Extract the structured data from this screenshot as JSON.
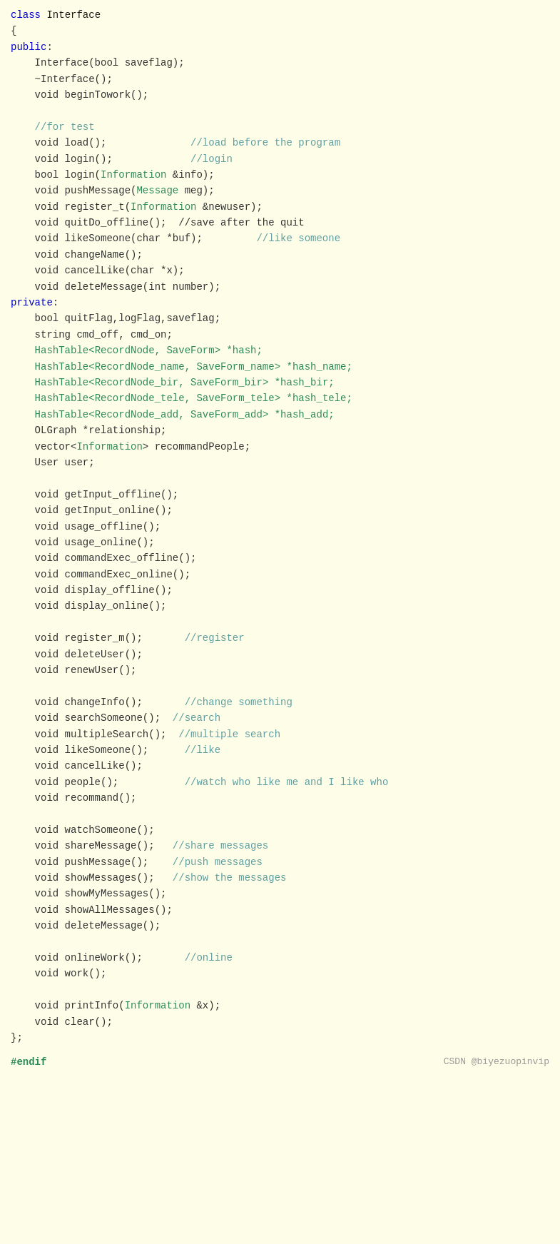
{
  "title": "Interface",
  "footer": {
    "left": "#endif",
    "right": "CSDN @biyezuopinvip"
  },
  "code": {
    "lines": [
      {
        "id": 1,
        "parts": [
          {
            "text": "class ",
            "style": "kw"
          },
          {
            "text": "Interface",
            "style": "class-name"
          }
        ]
      },
      {
        "id": 2,
        "parts": [
          {
            "text": "{",
            "style": "punct"
          }
        ]
      },
      {
        "id": 3,
        "parts": [
          {
            "text": "public",
            "style": "kw"
          },
          {
            "text": ":",
            "style": "punct"
          }
        ]
      },
      {
        "id": 4,
        "parts": [
          {
            "text": "    Interface(bool saveflag);",
            "style": "method"
          }
        ]
      },
      {
        "id": 5,
        "parts": [
          {
            "text": "    ~Interface();",
            "style": "method"
          }
        ]
      },
      {
        "id": 6,
        "parts": [
          {
            "text": "    void beginTowork();",
            "style": "method"
          }
        ]
      },
      {
        "id": 7,
        "parts": [
          {
            "text": "",
            "style": ""
          }
        ]
      },
      {
        "id": 8,
        "parts": [
          {
            "text": "    //for test",
            "style": "comment"
          }
        ]
      },
      {
        "id": 9,
        "parts": [
          {
            "text": "    void load();",
            "style": "method"
          },
          {
            "text": "              //load before the program",
            "style": "comment"
          }
        ]
      },
      {
        "id": 10,
        "parts": [
          {
            "text": "    void login();",
            "style": "method"
          },
          {
            "text": "             //login",
            "style": "comment"
          }
        ]
      },
      {
        "id": 11,
        "parts": [
          {
            "text": "    bool login(",
            "style": "method"
          },
          {
            "text": "Information",
            "style": "type-name"
          },
          {
            "text": " &info);",
            "style": "method"
          }
        ]
      },
      {
        "id": 12,
        "parts": [
          {
            "text": "    void pushMessage(",
            "style": "method"
          },
          {
            "text": "Message",
            "style": "type-name"
          },
          {
            "text": " meg);",
            "style": "method"
          }
        ]
      },
      {
        "id": 13,
        "parts": [
          {
            "text": "    void register_t(",
            "style": "method"
          },
          {
            "text": "Information",
            "style": "type-name"
          },
          {
            "text": " &newuser);",
            "style": "method"
          }
        ]
      },
      {
        "id": 14,
        "parts": [
          {
            "text": "    void quitDo_offline();  //save after the quit",
            "style": "method"
          },
          {
            "text": "",
            "style": "comment"
          }
        ]
      },
      {
        "id": 15,
        "parts": [
          {
            "text": "    void likeSomeone(char *buf);",
            "style": "method"
          },
          {
            "text": "         //like someone",
            "style": "comment"
          }
        ]
      },
      {
        "id": 16,
        "parts": [
          {
            "text": "    void changeName();",
            "style": "method"
          }
        ]
      },
      {
        "id": 17,
        "parts": [
          {
            "text": "    void cancelLike(char *x);",
            "style": "method"
          }
        ]
      },
      {
        "id": 18,
        "parts": [
          {
            "text": "    void deleteMessage(int number);",
            "style": "method"
          }
        ]
      },
      {
        "id": 19,
        "parts": [
          {
            "text": "private",
            "style": "kw"
          },
          {
            "text": ":",
            "style": "punct"
          }
        ]
      },
      {
        "id": 20,
        "parts": [
          {
            "text": "    bool quitFlag,logFlag,saveflag;",
            "style": "method"
          }
        ]
      },
      {
        "id": 21,
        "parts": [
          {
            "text": "    string cmd_off, cmd_on;",
            "style": "method"
          }
        ]
      },
      {
        "id": 22,
        "parts": [
          {
            "text": "    HashTable<",
            "style": "type-name"
          },
          {
            "text": "RecordNode, SaveForm",
            "style": "type-name"
          },
          {
            "text": "> *hash;",
            "style": "type-name"
          }
        ]
      },
      {
        "id": 23,
        "parts": [
          {
            "text": "    HashTable<",
            "style": "type-name"
          },
          {
            "text": "RecordNode_name, SaveForm_name",
            "style": "type-name"
          },
          {
            "text": "> *hash_name;",
            "style": "type-name"
          }
        ]
      },
      {
        "id": 24,
        "parts": [
          {
            "text": "    HashTable<",
            "style": "type-name"
          },
          {
            "text": "RecordNode_bir, SaveForm_bir",
            "style": "type-name"
          },
          {
            "text": "> *hash_bir;",
            "style": "type-name"
          }
        ]
      },
      {
        "id": 25,
        "parts": [
          {
            "text": "    HashTable<",
            "style": "type-name"
          },
          {
            "text": "RecordNode_tele, SaveForm_tele",
            "style": "type-name"
          },
          {
            "text": "> *hash_tele;",
            "style": "type-name"
          }
        ]
      },
      {
        "id": 26,
        "parts": [
          {
            "text": "    HashTable<",
            "style": "type-name"
          },
          {
            "text": "RecordNode_add, SaveForm_add",
            "style": "type-name"
          },
          {
            "text": "> *hash_add;",
            "style": "type-name"
          }
        ]
      },
      {
        "id": 27,
        "parts": [
          {
            "text": "    OLGraph *relationship;",
            "style": "method"
          }
        ]
      },
      {
        "id": 28,
        "parts": [
          {
            "text": "    vector<",
            "style": "method"
          },
          {
            "text": "Information",
            "style": "type-name"
          },
          {
            "text": "> recommandPeople;",
            "style": "method"
          }
        ]
      },
      {
        "id": 29,
        "parts": [
          {
            "text": "    User user;",
            "style": "method"
          }
        ]
      },
      {
        "id": 30,
        "parts": [
          {
            "text": "",
            "style": ""
          }
        ]
      },
      {
        "id": 31,
        "parts": [
          {
            "text": "    void getInput_offline();",
            "style": "method"
          }
        ]
      },
      {
        "id": 32,
        "parts": [
          {
            "text": "    void getInput_online();",
            "style": "method"
          }
        ]
      },
      {
        "id": 33,
        "parts": [
          {
            "text": "    void usage_offline();",
            "style": "method"
          }
        ]
      },
      {
        "id": 34,
        "parts": [
          {
            "text": "    void usage_online();",
            "style": "method"
          }
        ]
      },
      {
        "id": 35,
        "parts": [
          {
            "text": "    void commandExec_offline();",
            "style": "method"
          }
        ]
      },
      {
        "id": 36,
        "parts": [
          {
            "text": "    void commandExec_online();",
            "style": "method"
          }
        ]
      },
      {
        "id": 37,
        "parts": [
          {
            "text": "    void display_offline();",
            "style": "method"
          }
        ]
      },
      {
        "id": 38,
        "parts": [
          {
            "text": "    void display_online();",
            "style": "method"
          }
        ]
      },
      {
        "id": 39,
        "parts": [
          {
            "text": "",
            "style": ""
          }
        ]
      },
      {
        "id": 40,
        "parts": [
          {
            "text": "    void register_m();",
            "style": "method"
          },
          {
            "text": "       //register",
            "style": "comment"
          }
        ]
      },
      {
        "id": 41,
        "parts": [
          {
            "text": "    void deleteUser();",
            "style": "method"
          }
        ]
      },
      {
        "id": 42,
        "parts": [
          {
            "text": "    void renewUser();",
            "style": "method"
          }
        ]
      },
      {
        "id": 43,
        "parts": [
          {
            "text": "",
            "style": ""
          }
        ]
      },
      {
        "id": 44,
        "parts": [
          {
            "text": "    void changeInfo();",
            "style": "method"
          },
          {
            "text": "       //change something",
            "style": "comment"
          }
        ]
      },
      {
        "id": 45,
        "parts": [
          {
            "text": "    void searchSomeone();",
            "style": "method"
          },
          {
            "text": "  //search",
            "style": "comment"
          }
        ]
      },
      {
        "id": 46,
        "parts": [
          {
            "text": "    void multipleSearch();",
            "style": "method"
          },
          {
            "text": "  //multiple search",
            "style": "comment"
          }
        ]
      },
      {
        "id": 47,
        "parts": [
          {
            "text": "    void likeSomeone();",
            "style": "method"
          },
          {
            "text": "      //like",
            "style": "comment"
          }
        ]
      },
      {
        "id": 48,
        "parts": [
          {
            "text": "    void cancelLike();",
            "style": "method"
          }
        ]
      },
      {
        "id": 49,
        "parts": [
          {
            "text": "    void people();",
            "style": "method"
          },
          {
            "text": "           //watch who like me and I like who",
            "style": "comment"
          }
        ]
      },
      {
        "id": 50,
        "parts": [
          {
            "text": "    void recommand();",
            "style": "method"
          }
        ]
      },
      {
        "id": 51,
        "parts": [
          {
            "text": "",
            "style": ""
          }
        ]
      },
      {
        "id": 52,
        "parts": [
          {
            "text": "    void watchSomeone();",
            "style": "method"
          }
        ]
      },
      {
        "id": 53,
        "parts": [
          {
            "text": "    void shareMessage();",
            "style": "method"
          },
          {
            "text": "   //share messages",
            "style": "comment"
          }
        ]
      },
      {
        "id": 54,
        "parts": [
          {
            "text": "    void pushMessage();",
            "style": "method"
          },
          {
            "text": "    //push messages",
            "style": "comment"
          }
        ]
      },
      {
        "id": 55,
        "parts": [
          {
            "text": "    void showMessages();",
            "style": "method"
          },
          {
            "text": "   //show the messages",
            "style": "comment"
          }
        ]
      },
      {
        "id": 56,
        "parts": [
          {
            "text": "    void showMyMessages();",
            "style": "method"
          }
        ]
      },
      {
        "id": 57,
        "parts": [
          {
            "text": "    void showAllMessages();",
            "style": "method"
          }
        ]
      },
      {
        "id": 58,
        "parts": [
          {
            "text": "    void deleteMessage();",
            "style": "method"
          }
        ]
      },
      {
        "id": 59,
        "parts": [
          {
            "text": "",
            "style": ""
          }
        ]
      },
      {
        "id": 60,
        "parts": [
          {
            "text": "    void onlineWork();",
            "style": "method"
          },
          {
            "text": "       //online",
            "style": "comment"
          }
        ]
      },
      {
        "id": 61,
        "parts": [
          {
            "text": "    void work();",
            "style": "method"
          }
        ]
      },
      {
        "id": 62,
        "parts": [
          {
            "text": "",
            "style": ""
          }
        ]
      },
      {
        "id": 63,
        "parts": [
          {
            "text": "    void printInfo(",
            "style": "method"
          },
          {
            "text": "Information",
            "style": "type-name"
          },
          {
            "text": " &x);",
            "style": "method"
          }
        ]
      },
      {
        "id": 64,
        "parts": [
          {
            "text": "    void clear();",
            "style": "method"
          }
        ]
      },
      {
        "id": 65,
        "parts": [
          {
            "text": "};",
            "style": "punct"
          }
        ]
      }
    ]
  }
}
